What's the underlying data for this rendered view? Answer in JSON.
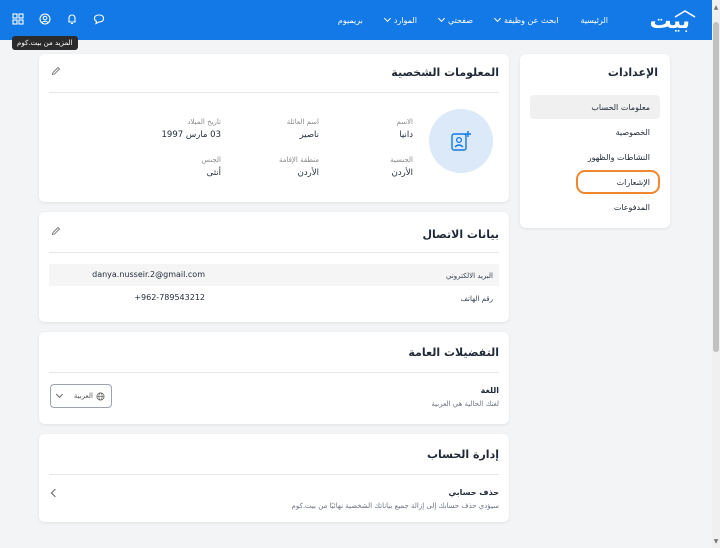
{
  "header": {
    "logo": "بيت",
    "nav": [
      {
        "label": "الرئيسية",
        "has_dropdown": false
      },
      {
        "label": "ابحث عن وظيفة",
        "has_dropdown": true
      },
      {
        "label": "صفحتي",
        "has_dropdown": true
      },
      {
        "label": "الموارد",
        "has_dropdown": true
      },
      {
        "label": "بريميوم",
        "has_dropdown": false
      }
    ],
    "icons": [
      "grid-icon",
      "user-circle-icon",
      "bell-icon",
      "chat-icon"
    ],
    "tooltip": "المزيد من بيت.كوم",
    "color": "#1279e6"
  },
  "settings": {
    "title": "الإعدادات",
    "items": [
      {
        "label": "معلومات الحساب",
        "active": true
      },
      {
        "label": "الخصوصية",
        "active": false
      },
      {
        "label": "النشاطات والظهور",
        "active": false
      },
      {
        "label": "الإشعارات",
        "active": false,
        "highlighted": true
      },
      {
        "label": "المدفوعات",
        "active": false
      }
    ]
  },
  "personal": {
    "title": "المعلومات الشخصية",
    "fields": {
      "first_name": {
        "label": "الاسم",
        "value": "دانيا"
      },
      "last_name": {
        "label": "اسم العائلة",
        "value": "ناصير"
      },
      "birth_date": {
        "label": "تاريخ الميلاد",
        "value": "03 مارس 1997"
      },
      "nationality": {
        "label": "الجنسية",
        "value": "الأردن"
      },
      "residence": {
        "label": "منطقة الإقامة",
        "value": "الأردن"
      },
      "gender": {
        "label": "الجنس",
        "value": "أنثى"
      }
    }
  },
  "contact": {
    "title": "بيانات الاتصال",
    "email_label": "البريد الالكتروني",
    "email_value": "danya.nusseir.2@gmail.com",
    "phone_label": "رقم الهاتف",
    "phone_value": "+962-789543212"
  },
  "preferences": {
    "title": "التفضيلات العامة",
    "language_title": "اللغة",
    "language_desc": "لغتك الحالية هي العربية",
    "language_selected": "العربية"
  },
  "account": {
    "title": "إدارة الحساب",
    "delete_title": "حذف حسابي",
    "delete_desc": "سيؤدي حذف حسابك إلى إزالة جميع بياناتك الشخصية نهائيًا من بيت.كوم"
  },
  "colors": {
    "accent": "#1279e6",
    "highlight": "#f0862e",
    "avatar_bg": "#dbe9f8"
  }
}
